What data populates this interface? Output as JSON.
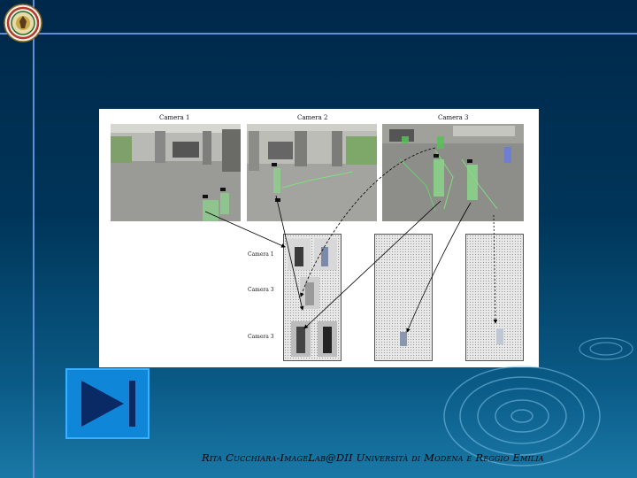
{
  "footer": {
    "text": "Rita Cucchiara-ImageLab@DII Università di Modena e Reggio Emilia"
  },
  "figure": {
    "cameras": [
      {
        "label": "Camera 1"
      },
      {
        "label": "Camera 2"
      },
      {
        "label": "Camera 3"
      }
    ],
    "rows": [
      {
        "label": "Camera 1"
      },
      {
        "label": "Camera 3"
      },
      {
        "label": "Camera 3"
      }
    ]
  },
  "colors": {
    "background_top": "#00284a",
    "background_bottom": "#1a78a6",
    "frame_lines": "#5b8fd6",
    "button_fill": "#0f86d8",
    "button_icon": "#0a2a66"
  },
  "icons": {
    "logo": "university-seal",
    "button": "play-next-icon"
  }
}
